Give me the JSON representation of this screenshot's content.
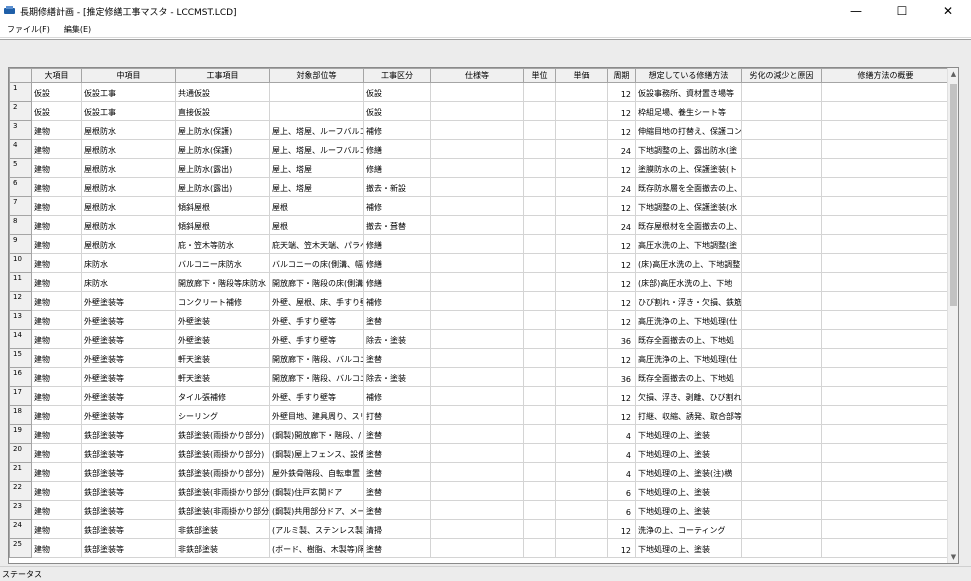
{
  "window": {
    "title": "長期修繕計画 - [推定修繕工事マスタ - LCCMST.LCD]",
    "minimize_glyph": "—",
    "maximize_glyph": "☐",
    "close_glyph": "✕"
  },
  "menu": {
    "file": "ファイル(F)",
    "edit": "編集(E)"
  },
  "grid": {
    "headers": [
      "大項目",
      "中項目",
      "工事項目",
      "対象部位等",
      "工事区分",
      "仕様等",
      "単位",
      "単価",
      "周期",
      "想定している修繕方法",
      "劣化の減少と原因",
      "修繕方法の概要"
    ],
    "rows": [
      {
        "n": "1",
        "c": [
          "仮設",
          "仮設工事",
          "共通仮設",
          "",
          "仮設",
          "",
          "",
          "",
          "12",
          "仮設事務所、資材置き場等",
          "",
          ""
        ]
      },
      {
        "n": "2",
        "c": [
          "仮設",
          "仮設工事",
          "直接仮設",
          "",
          "仮設",
          "",
          "",
          "",
          "12",
          "枠組足場、養生シート等",
          "",
          ""
        ]
      },
      {
        "n": "3",
        "c": [
          "建物",
          "屋根防水",
          "屋上防水(保護)",
          "屋上、塔屋、ルーフバルコニ",
          "補修",
          "",
          "",
          "",
          "12",
          "伸縮目地の打替え、保護コンク",
          "",
          ""
        ]
      },
      {
        "n": "4",
        "c": [
          "建物",
          "屋根防水",
          "屋上防水(保護)",
          "屋上、塔屋、ルーフバルコニ",
          "修繕",
          "",
          "",
          "",
          "24",
          "下地調整の上、露出防水(塗",
          "",
          ""
        ]
      },
      {
        "n": "5",
        "c": [
          "建物",
          "屋根防水",
          "屋上防水(露出)",
          "屋上、塔屋",
          "修繕",
          "",
          "",
          "",
          "12",
          "塗膜防水の上、保護塗装(ト",
          "",
          ""
        ]
      },
      {
        "n": "6",
        "c": [
          "建物",
          "屋根防水",
          "屋上防水(露出)",
          "屋上、塔屋",
          "撤去・新設",
          "",
          "",
          "",
          "24",
          "既存防水層を全面撤去の上、",
          "",
          ""
        ]
      },
      {
        "n": "7",
        "c": [
          "建物",
          "屋根防水",
          "傾斜屋根",
          "屋根",
          "補修",
          "",
          "",
          "",
          "12",
          "下地調整の上、保護塗装(水",
          "",
          ""
        ]
      },
      {
        "n": "8",
        "c": [
          "建物",
          "屋根防水",
          "傾斜屋根",
          "屋根",
          "撤去・葺替",
          "",
          "",
          "",
          "24",
          "既存屋根材を全面撤去の上、",
          "",
          ""
        ]
      },
      {
        "n": "9",
        "c": [
          "建物",
          "屋根防水",
          "庇・笠木等防水",
          "庇天端、笠木天端、パラペ",
          "修繕",
          "",
          "",
          "",
          "12",
          "高圧水洗の上、下地調整(塗",
          "",
          ""
        ]
      },
      {
        "n": "10",
        "c": [
          "建物",
          "床防水",
          "バルコニー床防水",
          "バルコニーの床(側溝、幅木",
          "修繕",
          "",
          "",
          "",
          "12",
          "(床)高圧水洗の上、下地調整",
          "",
          ""
        ]
      },
      {
        "n": "11",
        "c": [
          "建物",
          "床防水",
          "開放廊下・階段等床防水",
          "開放廊下・階段の床(側溝",
          "修繕",
          "",
          "",
          "",
          "12",
          "(床部)高圧水洗の上、下地",
          "",
          ""
        ]
      },
      {
        "n": "12",
        "c": [
          "建物",
          "外壁塗装等",
          "コンクリート補修",
          "外壁、屋根、床、手すり壁",
          "補修",
          "",
          "",
          "",
          "12",
          "ひび割れ・浮き・欠損、鉄筋の",
          "",
          ""
        ]
      },
      {
        "n": "13",
        "c": [
          "建物",
          "外壁塗装等",
          "外壁塗装",
          "外壁、手すり壁等",
          "塗替",
          "",
          "",
          "",
          "12",
          "高圧洗浄の上、下地処理(仕",
          "",
          ""
        ]
      },
      {
        "n": "14",
        "c": [
          "建物",
          "外壁塗装等",
          "外壁塗装",
          "外壁、手すり壁等",
          "除去・塗装",
          "",
          "",
          "",
          "36",
          "既存全面撤去の上、下地処",
          "",
          ""
        ]
      },
      {
        "n": "15",
        "c": [
          "建物",
          "外壁塗装等",
          "軒天塗装",
          "開放廊下・階段、バルコニー",
          "塗替",
          "",
          "",
          "",
          "12",
          "高圧洗浄の上、下地処理(仕",
          "",
          ""
        ]
      },
      {
        "n": "16",
        "c": [
          "建物",
          "外壁塗装等",
          "軒天塗装",
          "開放廊下・階段、バルコニー",
          "除去・塗装",
          "",
          "",
          "",
          "36",
          "既存全面撤去の上、下地処",
          "",
          ""
        ]
      },
      {
        "n": "17",
        "c": [
          "建物",
          "外壁塗装等",
          "タイル張補修",
          "外壁、手すり壁等",
          "補修",
          "",
          "",
          "",
          "12",
          "欠損、浮き、剥離、ひび割れの",
          "",
          ""
        ]
      },
      {
        "n": "18",
        "c": [
          "建物",
          "外壁塗装等",
          "シーリング",
          "外壁目地、建具周り、スリー",
          "打替",
          "",
          "",
          "",
          "12",
          "打継、収縮、誘発、取合部等",
          "",
          ""
        ]
      },
      {
        "n": "19",
        "c": [
          "建物",
          "鉄部塗装等",
          "鉄部塗装(雨掛かり部分)",
          "(鋼製)開放廊下・階段、/",
          "塗替",
          "",
          "",
          "",
          "4",
          "下地処理の上、塗装",
          "",
          ""
        ]
      },
      {
        "n": "20",
        "c": [
          "建物",
          "鉄部塗装等",
          "鉄部塗装(雨掛かり部分)",
          "(鋼製)屋上フェンス、設備",
          "塗替",
          "",
          "",
          "",
          "4",
          "下地処理の上、塗装",
          "",
          ""
        ]
      },
      {
        "n": "21",
        "c": [
          "建物",
          "鉄部塗装等",
          "鉄部塗装(雨掛かり部分)",
          "屋外鉄骨階段、自転車置",
          "塗替",
          "",
          "",
          "",
          "4",
          "下地処理の上、塗装(注)横",
          "",
          ""
        ]
      },
      {
        "n": "22",
        "c": [
          "建物",
          "鉄部塗装等",
          "鉄部塗装(非雨掛かり部分)",
          "(鋼製)住戸玄関ドア",
          "塗替",
          "",
          "",
          "",
          "6",
          "下地処理の上、塗装",
          "",
          ""
        ]
      },
      {
        "n": "23",
        "c": [
          "建物",
          "鉄部塗装等",
          "鉄部塗装(非雨掛かり部分)",
          "(鋼製)共用部分ドア、メー",
          "塗替",
          "",
          "",
          "",
          "6",
          "下地処理の上、塗装",
          "",
          ""
        ]
      },
      {
        "n": "24",
        "c": [
          "建物",
          "鉄部塗装等",
          "非鉄部塗装",
          "(アルミ製、ステンレス製等)",
          "清掃",
          "",
          "",
          "",
          "12",
          "洗浄の上、コーティング",
          "",
          ""
        ]
      },
      {
        "n": "25",
        "c": [
          "建物",
          "鉄部塗装等",
          "非鉄部塗装",
          "(ボード、樹脂、木製等)隔",
          "塗替",
          "",
          "",
          "",
          "12",
          "下地処理の上、塗装",
          "",
          ""
        ]
      }
    ]
  },
  "status": {
    "text": "ステータス"
  },
  "icons": {
    "app": "app-icon",
    "scroll_up": "▲",
    "scroll_down": "▼"
  }
}
